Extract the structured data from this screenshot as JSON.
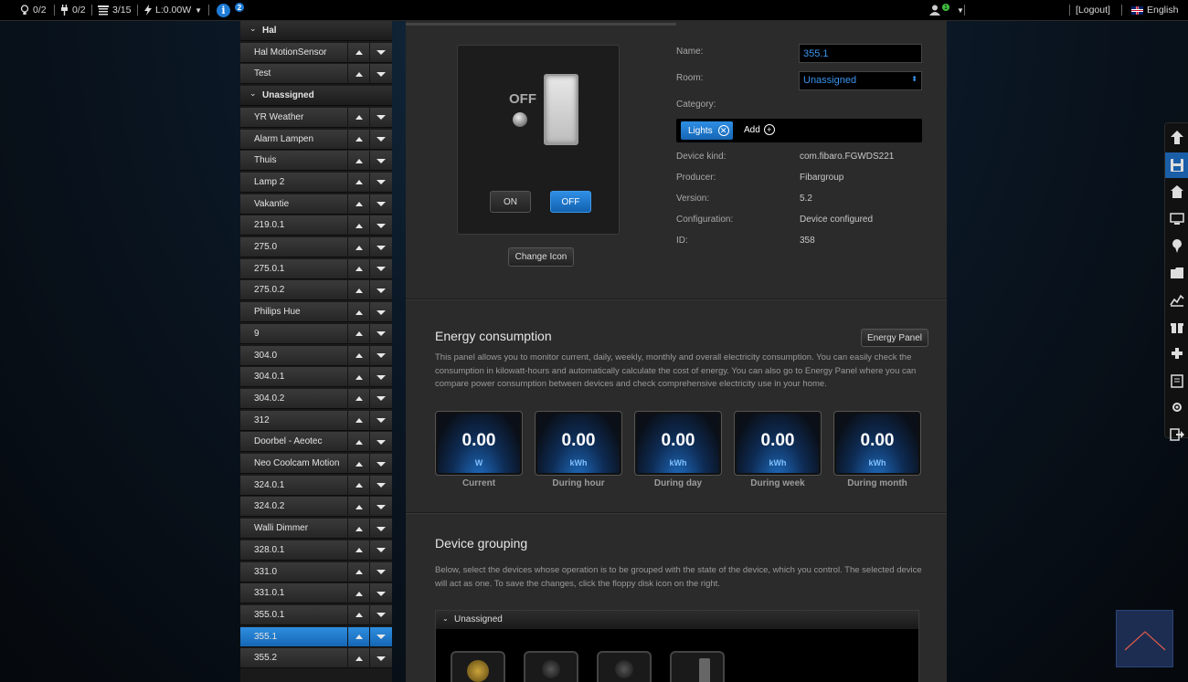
{
  "topbar": {
    "lights": "0/2",
    "plugs": "0/2",
    "blinds": "3/15",
    "power": "L:0.00W",
    "info_badge": "2",
    "user_badge": "1",
    "logout": "[Logout]",
    "language": "English"
  },
  "sidebar": {
    "rows": [
      {
        "label": "Hal",
        "type": "section"
      },
      {
        "label": "Hal MotionSensor",
        "type": "item"
      },
      {
        "label": "Test",
        "type": "item"
      },
      {
        "label": "Unassigned",
        "type": "section"
      },
      {
        "label": "YR Weather",
        "type": "item"
      },
      {
        "label": "Alarm Lampen",
        "type": "item"
      },
      {
        "label": "Thuis",
        "type": "item"
      },
      {
        "label": "Lamp 2",
        "type": "item"
      },
      {
        "label": "Vakantie",
        "type": "item"
      },
      {
        "label": "219.0.1",
        "type": "item"
      },
      {
        "label": "275.0",
        "type": "item"
      },
      {
        "label": "275.0.1",
        "type": "item"
      },
      {
        "label": "275.0.2",
        "type": "item"
      },
      {
        "label": "Philips Hue",
        "type": "item"
      },
      {
        "label": "9",
        "type": "item"
      },
      {
        "label": "304.0",
        "type": "item"
      },
      {
        "label": "304.0.1",
        "type": "item"
      },
      {
        "label": "304.0.2",
        "type": "item"
      },
      {
        "label": "312",
        "type": "item"
      },
      {
        "label": "Doorbel - Aeotec",
        "type": "item"
      },
      {
        "label": "Neo Coolcam Motion",
        "type": "item"
      },
      {
        "label": "324.0.1",
        "type": "item"
      },
      {
        "label": "324.0.2",
        "type": "item"
      },
      {
        "label": "Walli Dimmer",
        "type": "item"
      },
      {
        "label": "328.0.1",
        "type": "item"
      },
      {
        "label": "331.0",
        "type": "item"
      },
      {
        "label": "331.0.1",
        "type": "item"
      },
      {
        "label": "355.0.1",
        "type": "item"
      },
      {
        "label": "355.1",
        "type": "active"
      },
      {
        "label": "355.2",
        "type": "item"
      }
    ]
  },
  "device": {
    "state_text": "OFF",
    "on_button": "ON",
    "off_button": "OFF",
    "change_icon": "Change Icon"
  },
  "properties": {
    "name_label": "Name:",
    "name_value": "355.1",
    "room_label": "Room:",
    "room_value": "Unassigned",
    "category_label": "Category:",
    "category_tag": "Lights",
    "add_label": "Add",
    "device_kind_label": "Device kind:",
    "device_kind": "com.fibaro.FGWDS221",
    "producer_label": "Producer:",
    "producer": "Fibargroup",
    "version_label": "Version:",
    "version": "5.2",
    "configuration_label": "Configuration:",
    "configuration": "Device configured",
    "id_label": "ID:",
    "id": "358"
  },
  "energy": {
    "title": "Energy consumption",
    "panel_button": "Energy Panel",
    "description": "This panel allows you to monitor current, daily, weekly, monthly and overall electricity consumption. You can easily check the consumption in kilowatt-hours and automatically calculate the cost of energy. You can also go to Energy Panel where you can compare power consumption between devices and check comprehensive electricity use in your home.",
    "meters": [
      {
        "value": "0.00",
        "unit": "W",
        "caption": "Current"
      },
      {
        "value": "0.00",
        "unit": "kWh",
        "caption": "During hour"
      },
      {
        "value": "0.00",
        "unit": "kWh",
        "caption": "During day"
      },
      {
        "value": "0.00",
        "unit": "kWh",
        "caption": "During week"
      },
      {
        "value": "0.00",
        "unit": "kWh",
        "caption": "During month"
      }
    ]
  },
  "grouping": {
    "title": "Device grouping",
    "description": "Below, select the devices whose operation is to be grouped with the state of the device, which you control. The selected device will act as one. To save the changes, click the floppy disk icon on the right.",
    "group_header": "Unassigned"
  },
  "rail": [
    "up-arrow-icon",
    "save-icon",
    "home-icon",
    "monitor-icon",
    "pin-icon",
    "folder-icon",
    "chart-icon",
    "gift-icon",
    "plugin-icon",
    "clipboard-icon",
    "settings-icon",
    "exit-icon"
  ],
  "colors": {
    "accent": "#1e7bd6",
    "active_row": "#1f78cc"
  }
}
